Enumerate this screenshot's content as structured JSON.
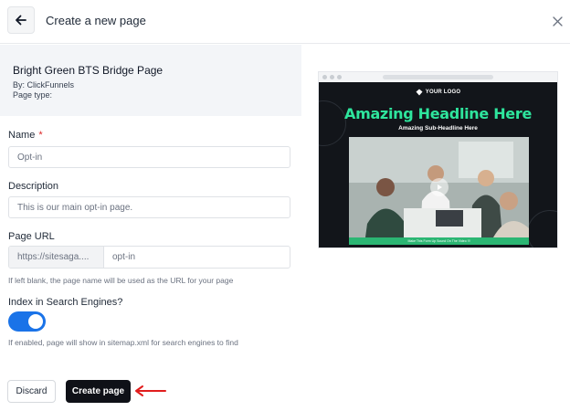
{
  "header": {
    "title": "Create a new page",
    "back_icon": "arrow-left-icon",
    "close_icon": "close-icon"
  },
  "template": {
    "name": "Bright Green BTS Bridge Page",
    "by": "By: ClickFunnels",
    "page_type": "Page type:"
  },
  "form": {
    "name": {
      "label": "Name",
      "required_mark": "*",
      "placeholder": "Opt-in"
    },
    "description": {
      "label": "Description",
      "placeholder": "This is our main opt-in page."
    },
    "page_url": {
      "label": "Page URL",
      "prefix": "https://sitesaga....",
      "slug_placeholder": "opt-in",
      "hint": "If left blank, the page name will be used as the URL for your page"
    },
    "index": {
      "label": "Index in Search Engines?",
      "enabled": true,
      "hint": "If enabled, page will show in sitemap.xml for search engines to find"
    }
  },
  "actions": {
    "discard_label": "Discard",
    "create_label": "Create page"
  },
  "preview": {
    "logo_text": "YOUR LOGO",
    "headline": "Amazing Headline Here",
    "subheadline": "Amazing Sub-Headline Here",
    "bar_text": "Make This Form Up Sound On The Video !!!",
    "play_icon": "play-icon"
  },
  "colors": {
    "accent": "#1a73e8",
    "headline_green": "#2ee59d",
    "create_button": "#0f1117",
    "annotation_arrow": "#e11d1d"
  }
}
